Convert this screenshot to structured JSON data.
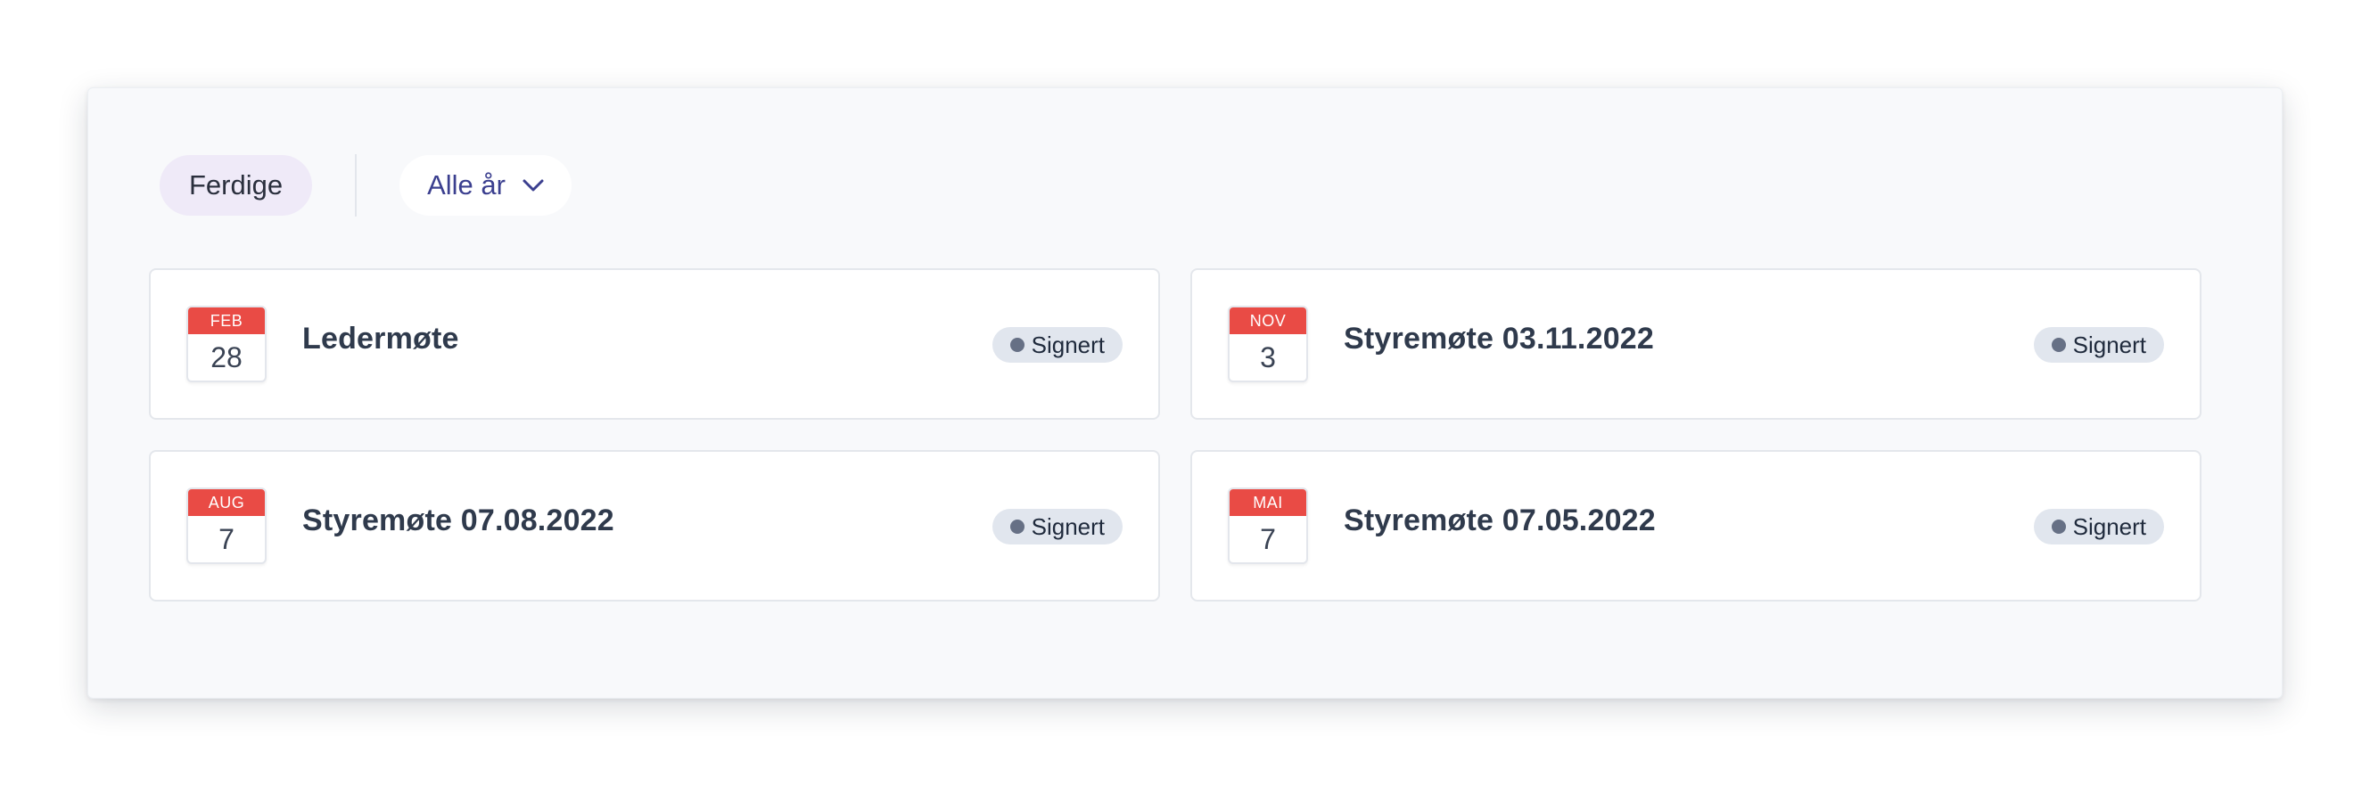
{
  "filters": {
    "status_label": "Ferdige",
    "year_label": "Alle år"
  },
  "meetings": [
    {
      "month": "FEB",
      "day": "28",
      "title": "Ledermøte",
      "status": "Signert"
    },
    {
      "month": "NOV",
      "day": "3",
      "title": "Styremøte 03.11.2022",
      "status": "Signert"
    },
    {
      "month": "AUG",
      "day": "7",
      "title": "Styremøte 07.08.2022",
      "status": "Signert"
    },
    {
      "month": "MAI",
      "day": "7",
      "title": "Styremøte 07.05.2022",
      "status": "Signert"
    }
  ],
  "colors": {
    "calendar_header": "#e94b45",
    "active_filter_bg": "#efeaf8",
    "year_select_text": "#3b3f8f",
    "badge_bg": "#e1e6ee"
  },
  "icons": {
    "year_select": "chevron-down-icon",
    "status": "status-dot-icon"
  }
}
